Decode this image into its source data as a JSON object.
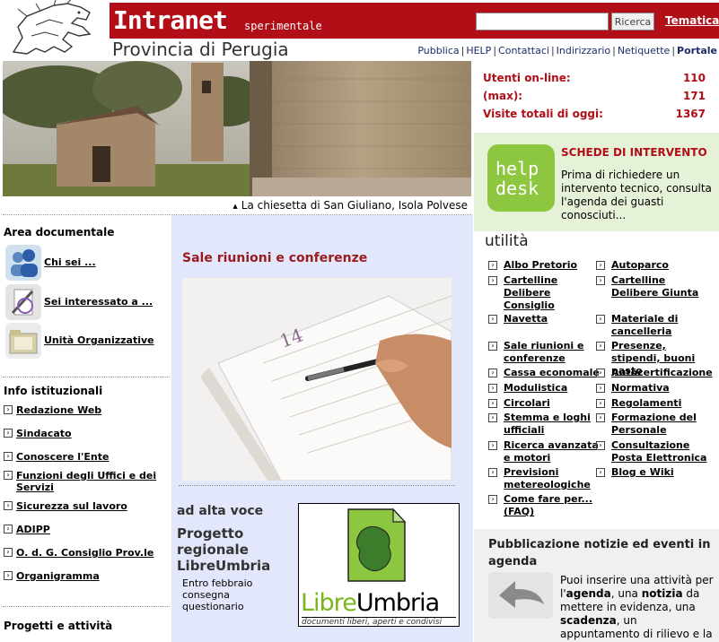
{
  "header": {
    "title": "Intranet",
    "subtitle": "sperimentale",
    "search_placeholder": "",
    "search_button": "Ricerca",
    "tematica": "Tematica",
    "provincia": "Provincia di Perugia",
    "nav": [
      "Pubblica",
      "HELP",
      "Contattaci",
      "Indirizzario",
      "Netiquette",
      "Portale"
    ]
  },
  "hero": {
    "caption": "La chiesetta di San Giuliano, Isola Polvese"
  },
  "stats": [
    {
      "label": "Utenti on-line:",
      "value": "110"
    },
    {
      "label": "(max):",
      "value": "171"
    },
    {
      "label": "Visite totali di oggi:",
      "value": "1367"
    }
  ],
  "helpdesk": {
    "icon_text_1": "help",
    "icon_text_2": "desk",
    "title": "SCHEDE DI INTERVENTO",
    "text": "Prima di richiedere un intervento tecnico, consulta l'agenda dei guasti conosciuti..."
  },
  "left": {
    "area_title": "Area documentale",
    "area_items": [
      "Chi sei ...",
      "Sei interessato a ...",
      "Unità Organizzative"
    ],
    "info_title": "Info istituzionali",
    "info_items": [
      "Redazione Web",
      "Sindacato",
      "Conoscere l'Ente",
      "Funzioni degli Uffici e dei Servizi",
      "Sicurezza sul lavoro",
      "ADIPP",
      "O. d. G. Consiglio Prov.le",
      "Organigramma"
    ],
    "progetti_title": "Progetti e attività"
  },
  "center": {
    "sale_title": "Sale riunioni e conferenze",
    "photo_day": "14",
    "ad_alta_voce": "ad alta voce",
    "progetto_title": "Progetto regionale LibreUmbria",
    "progetto_text": "Entro febbraio consegna questionario",
    "logo_libre": "Libre",
    "logo_umbria": "Umbria",
    "logo_sub": "documenti liberi, aperti e condivisi"
  },
  "utilita": {
    "title": "utilità",
    "col1": [
      "Albo Pretorio",
      "Cartelline Delibere Consiglio",
      "Navetta",
      "Sale riunioni e conferenze",
      "Cassa economale",
      "Modulistica",
      "Circolari",
      "Stemma e loghi ufficiali",
      "Ricerca avanzata e motori",
      "Previsioni metereologiche",
      "Come fare per... (FAQ)"
    ],
    "col2": [
      "Autoparco",
      "Cartelline Delibere Giunta",
      "Materiale di cancelleria",
      "Presenze, stipendi, buoni pasto",
      "Autocertificazione",
      "Normativa",
      "Regolamenti",
      "Formazione del Personale",
      "Consultazione Posta Elettronica",
      "Blog e Wiki"
    ]
  },
  "pub": {
    "title": "Pubblicazione notizie ed eventi in agenda",
    "text_1": "Puoi inserire una attività per l'",
    "agenda": "agenda",
    "text_2": ", una ",
    "notizia": "notizia",
    "text_3": " da mettere in evidenza, una ",
    "scadenza": "scadenza",
    "text_4": ", un appuntamento di rilievo e la"
  },
  "colors": {
    "brand_red": "#b20e18",
    "helpdesk_green": "#8dc63f",
    "center_bg": "#e3e7fb"
  }
}
